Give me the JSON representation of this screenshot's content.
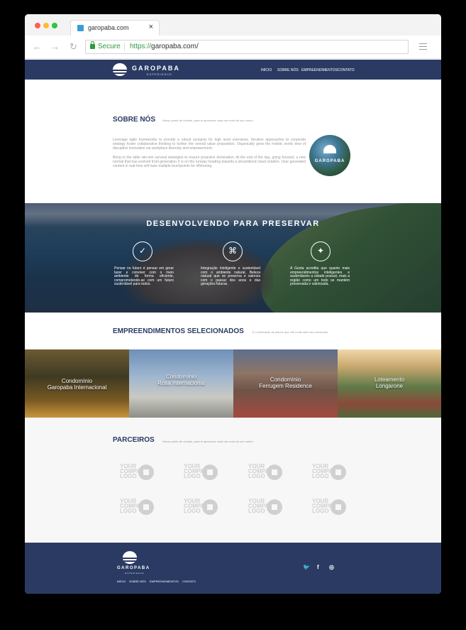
{
  "browser": {
    "tab_title": "garopaba.com",
    "tab_close": "×",
    "secure_label": "Secure",
    "url_scheme": "https://",
    "url_host": "garopaba.com/",
    "back_glyph": "←",
    "forward_glyph": "→",
    "reload_glyph": "↻"
  },
  "header": {
    "logo_word": "GAROPABA",
    "logo_sub": "EXPERIENCE",
    "nav": [
      "INÍCIO",
      "SOBRE NÓS",
      "EMPREENDIMENTOS",
      "CONTATO"
    ]
  },
  "about": {
    "title": "SOBRE NÓS",
    "subtitle": "Nosso ponto de contato, para te aproximar cada vez mais do seu sonho.",
    "paragraph_1": "Leverage agile frameworks to provide a robust synopsis for high level overviews. Iterative approaches to corporate strategy foster collaborative thinking to further the overall value proposition. Organically grow the holistic world view of disruptive innovation via workplace diversity and empowerment.",
    "paragraph_2": "Bring to the table win-win survival strategies to ensure proactive domination. At the end of the day, going forward, a new normal that has evolved from generation X is on the runway heading towards a streamlined cloud solution. User generated content in real-time will have multiple touchpoints for offshoring.",
    "badge_word": "GAROPABA"
  },
  "hero": {
    "title": "DESENVOLVENDO PARA PRESERVAR",
    "features": [
      {
        "icon": "check-circle-icon",
        "glyph": "✓",
        "text": "Pensar no futuro é pensar em gerar lazer e conviver com o meio ambiente de forma eficiente, comprometendo-se com um futuro sustentável para todos."
      },
      {
        "icon": "map-icon",
        "glyph": "⌘",
        "text": "Integração inteligente e sustentável com o ambiente natural. Beleza natural que se preserva e valoriza com o passar dos anos e das gerações futuras."
      },
      {
        "icon": "compass-icon",
        "glyph": "✦",
        "text": "A Gesta acredita que quanto mais empreendimentos inteligentes e sustentáveis a cidade possuir, mais a região como um todo se mantém preservada e valorizada."
      }
    ]
  },
  "selected": {
    "title": "EMPREENDIMENTOS SELECIONADOS",
    "subtitle": "É a efetivação de planos que vão muito além da construção.",
    "projects": [
      {
        "label_1": "Condomínio",
        "label_2": "Garopaba Internacional"
      },
      {
        "label_1": "Condomínio",
        "label_2": "Rosa Internacional"
      },
      {
        "label_1": "Condomínio",
        "label_2": "Ferrugem Residence"
      },
      {
        "label_1": "Loteamento",
        "label_2": "Longarone"
      }
    ]
  },
  "partners": {
    "title": "PARCEIROS",
    "subtitle": "Nosso ponto de contato, para te aproximar cada vez mais do seu sonho.",
    "placeholder_text": "YOUR COMPANY LOGO"
  },
  "footer": {
    "logo_word": "GAROPABA",
    "logo_sub": "EXPERIENCE",
    "links": [
      "INÍCIO",
      "SOBRE NÓS",
      "EMPREENDIMENTOS",
      "CONTATO"
    ],
    "social": {
      "twitter": "🐦",
      "facebook": "f",
      "instagram": "◎"
    }
  }
}
